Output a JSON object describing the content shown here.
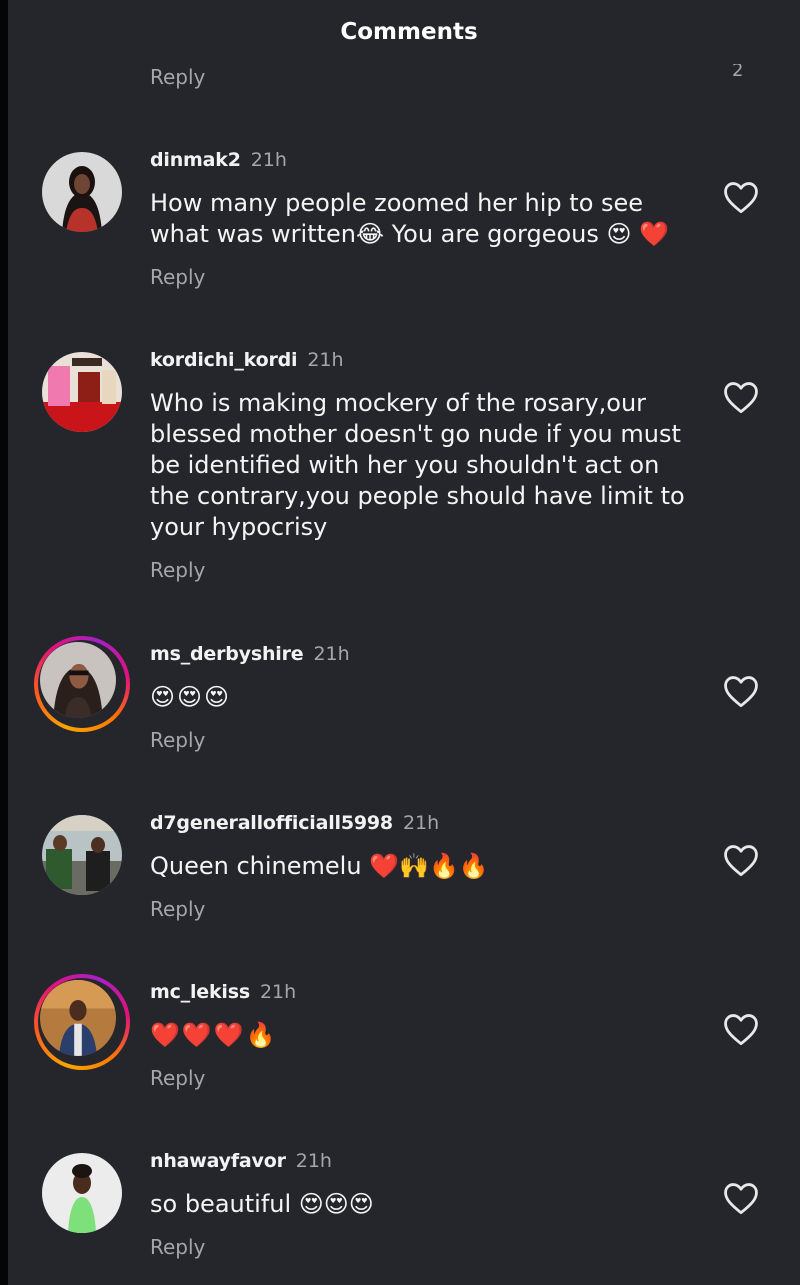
{
  "header": {
    "title": "Comments"
  },
  "top_partial": {
    "reply_label": "Reply",
    "count_fragment": "2"
  },
  "comments": [
    {
      "username": "dinmak2",
      "time": "21h",
      "text": "How many people zoomed her hip to see\nwhat was written😂 You are gorgeous 😍 ❤️",
      "reply_label": "Reply"
    },
    {
      "username": "kordichi_kordi",
      "time": "21h",
      "text": "Who is making mockery of the rosary,our\nblessed mother doesn't go nude if you must\nbe identified with her you shouldn't act on\nthe contrary,you people should have limit to\nyour hypocrisy",
      "reply_label": "Reply"
    },
    {
      "username": "ms_derbyshire",
      "time": "21h",
      "text": "😍😍😍",
      "reply_label": "Reply"
    },
    {
      "username": "d7generallofficiall5998",
      "time": "21h",
      "text": "Queen chinemelu ❤️🙌🔥🔥",
      "reply_label": "Reply"
    },
    {
      "username": "mc_lekiss",
      "time": "21h",
      "text": "❤️❤️❤️🔥",
      "reply_label": "Reply"
    },
    {
      "username": "nhawayfavor",
      "time": "21h",
      "text": "so beautiful 😍😍😍",
      "reply_label": "Reply"
    }
  ],
  "icons": {
    "like": "heart-outline-icon"
  },
  "colors": {
    "background": "#25262b",
    "text_primary": "#f2f2f2",
    "text_secondary": "#a5a6aa",
    "story_ring_start": "#f7a600",
    "story_ring_end": "#a620c9"
  }
}
